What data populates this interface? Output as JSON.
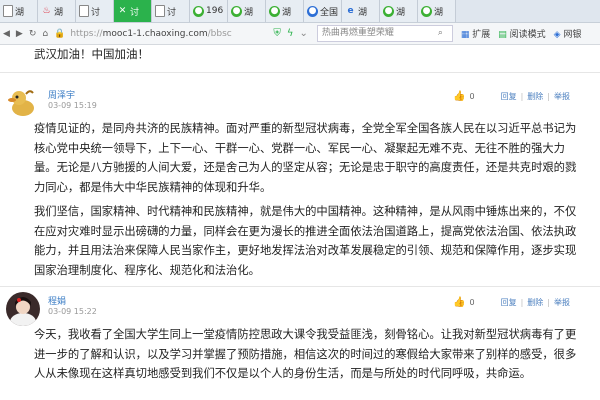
{
  "tabs": [
    {
      "icon": "doc",
      "label": "湖"
    },
    {
      "icon": "red",
      "label": "湖"
    },
    {
      "icon": "doc",
      "label": "讨"
    },
    {
      "icon": "close",
      "label": "讨"
    },
    {
      "icon": "doc",
      "label": "讨"
    },
    {
      "icon": "wx",
      "label": "196"
    },
    {
      "icon": "wx",
      "label": "湖"
    },
    {
      "icon": "wx",
      "label": "湖"
    },
    {
      "icon": "blue",
      "label": "全国"
    },
    {
      "icon": "ie",
      "label": "湖"
    },
    {
      "icon": "wx",
      "label": "湖"
    },
    {
      "icon": "wx",
      "label": "湖"
    }
  ],
  "address": {
    "url_prefix": "https://",
    "url_host": "mooc1-1.chaoxing.com",
    "url_path": "/bbsc",
    "search_placeholder": "热曲再燃重塑荣耀",
    "extension_label": "扩展",
    "reader_label": "阅读模式",
    "netbank_label": "网银"
  },
  "top_text": "武汉加油！中国加油！",
  "posts": [
    {
      "username": "周泽宇",
      "date": "03-09 15:19",
      "like_count": "0",
      "reply_label": "回复",
      "delete_label": "删除",
      "report_label": "举报",
      "paragraphs": [
        "疫情见证的，是同舟共济的民族精神。面对严重的新型冠状病毒，全党全军全国各族人民在以习近平总书记为核心党中央统一领导下，上下一心、干群一心、党群一心、军民一心、凝聚起无难不克、无往不胜的强大力量。无论是八方驰援的人间大爱，还是舍己为人的坚定从容；无论是忠于职守的高度责任，还是共克时艰的戮力同心，都是伟大中华民族精神的体现和升华。",
        "我们坚信，国家精神、时代精神和民族精神，就是伟大的中国精神。这种精神，是从风雨中锤炼出来的，不仅在应对灾难时显示出磅礴的力量，同样会在更为漫长的推进全面依法治国道路上，提高党依法治国、依法执政能力，并且用法治来保障人民当家作主，更好地发挥法治对改革发展稳定的引领、规范和保障作用，逐步实现国家治理制度化、程序化、规范化和法治化。"
      ]
    },
    {
      "username": "程娟",
      "date": "03-09 15:22",
      "like_count": "0",
      "reply_label": "回复",
      "delete_label": "删除",
      "report_label": "举报",
      "paragraphs": [
        "今天，我收看了全国大学生同上一堂疫情防控思政大课令我受益匪浅，刻骨铭心。让我对新型冠状病毒有了更进一步的了解和认识，以及学习并掌握了预防措施，相信这次的时间过的寒假给大家带来了别样的感受，很多人从未像现在这样真切地感受到我们不仅是以个人的身份生活，而是与所处的时代同呼吸，共命运。"
      ]
    }
  ],
  "colors": {
    "accent_green": "#2bb24c",
    "link_blue": "#4b7fbf",
    "name_blue": "#3a7cc5"
  }
}
